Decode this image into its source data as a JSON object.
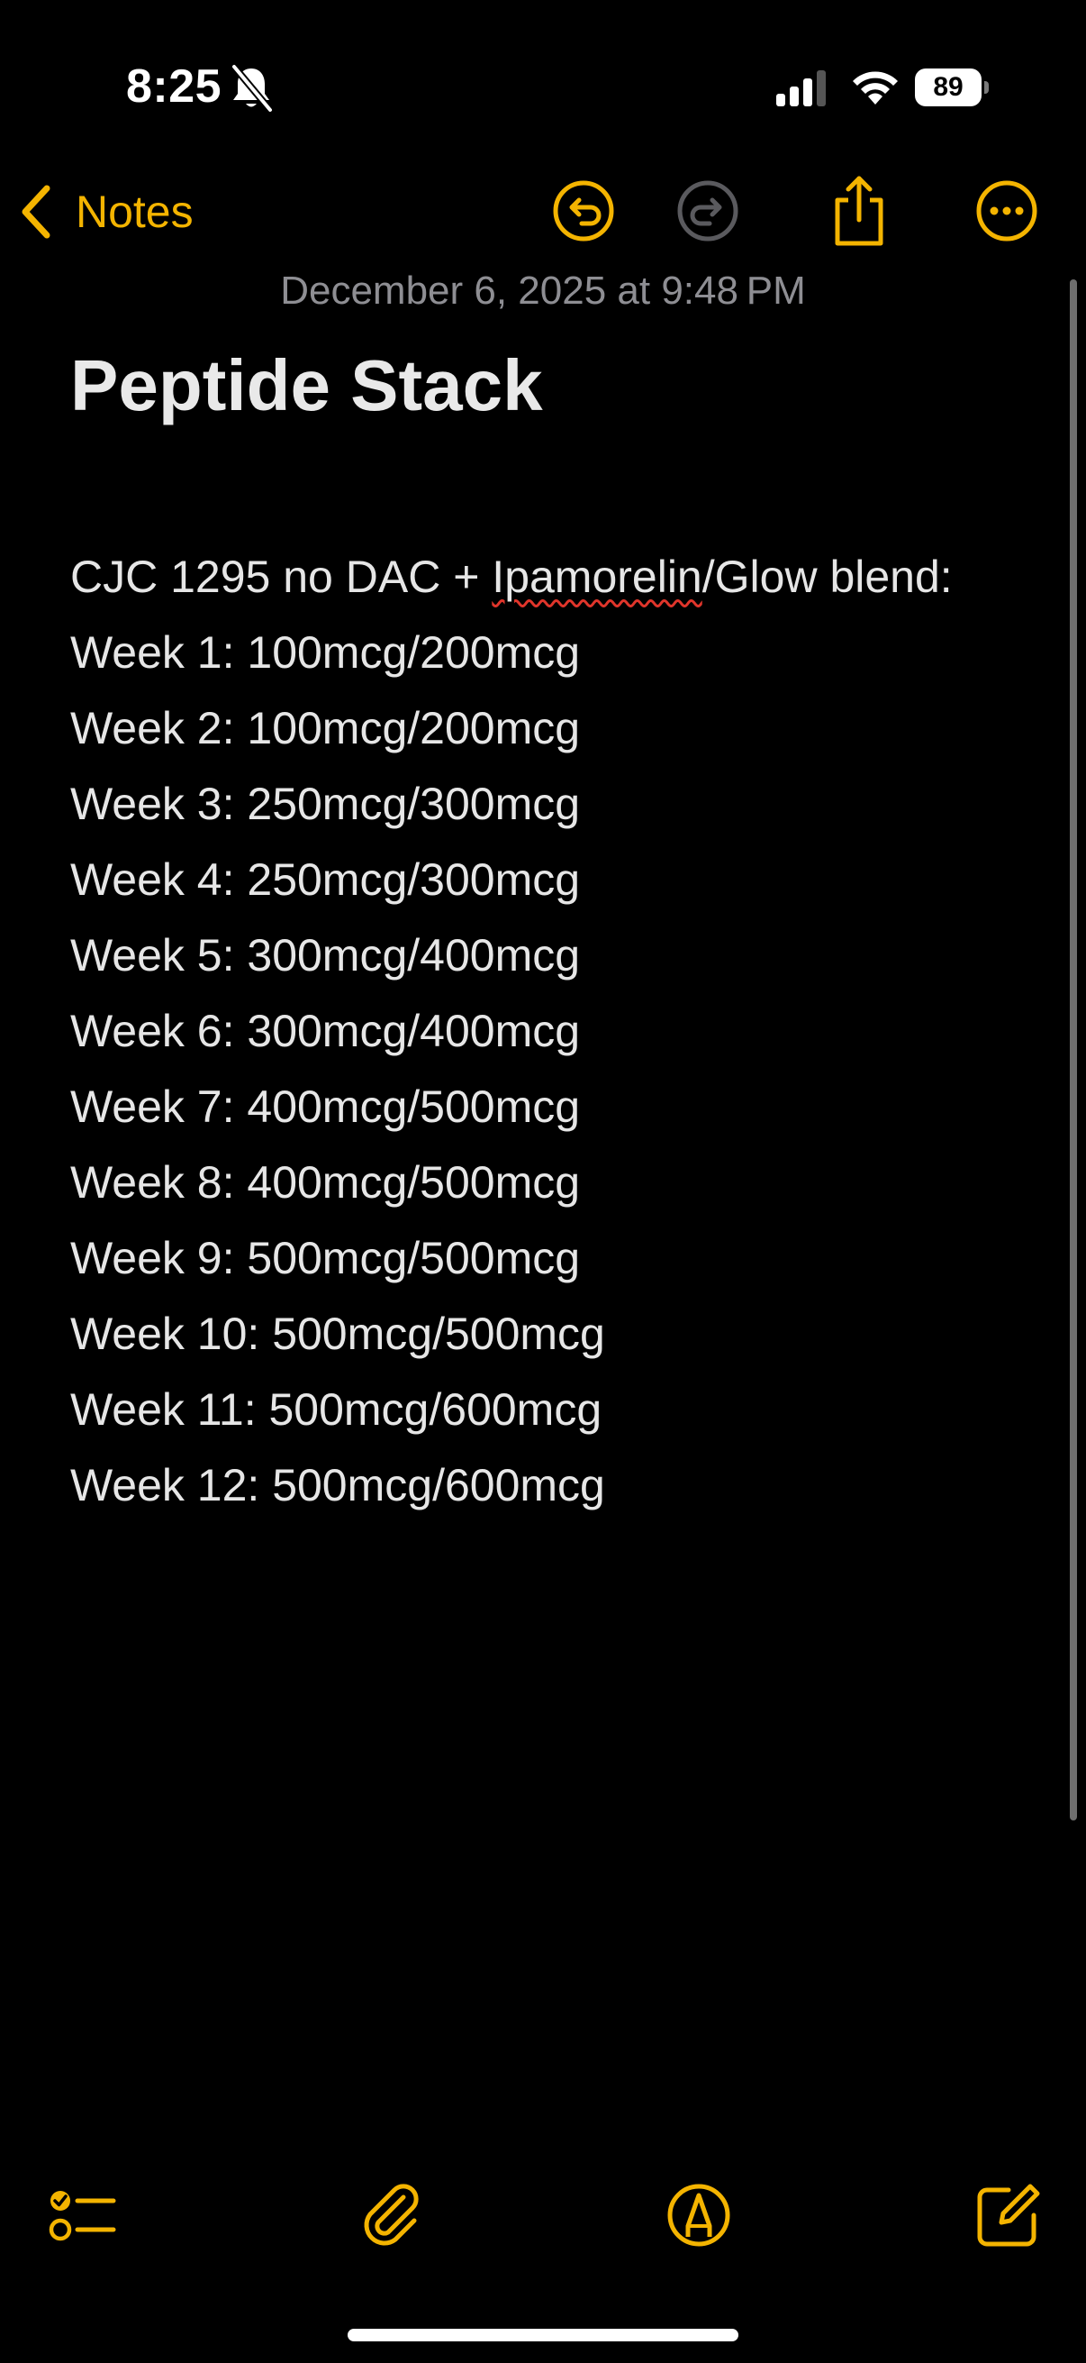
{
  "status_bar": {
    "time": "8:25",
    "battery": "89"
  },
  "nav": {
    "back_label": "Notes",
    "icons": [
      "undo-icon",
      "redo-icon",
      "share-icon",
      "more-icon"
    ]
  },
  "note": {
    "date": "December 6, 2025 at 9:48 PM",
    "title": "Peptide Stack",
    "intro": {
      "before": "CJC 1295 no DAC + ",
      "misspelled": "Ipamorelin",
      "after": "/Glow blend:"
    },
    "lines": [
      "Week 1: 100mcg/200mcg",
      "Week 2: 100mcg/200mcg",
      "Week 3: 250mcg/300mcg",
      "Week 4: 250mcg/300mcg",
      "Week 5: 300mcg/400mcg",
      "Week 6: 300mcg/400mcg",
      "Week 7: 400mcg/500mcg",
      "Week 8: 400mcg/500mcg",
      "Week 9: 500mcg/500mcg",
      "Week 10: 500mcg/500mcg",
      "Week 11: 500mcg/600mcg",
      "Week 12: 500mcg/600mcg"
    ]
  },
  "toolbar": {
    "icons": [
      "checklist-icon",
      "attachment-icon",
      "markup-icon",
      "compose-icon"
    ]
  },
  "colors": {
    "accent": "#f4b400",
    "background": "#000000",
    "text": "#e6e6e6",
    "secondary_text": "#8e8e93",
    "spellcheck": "#e0352b"
  }
}
